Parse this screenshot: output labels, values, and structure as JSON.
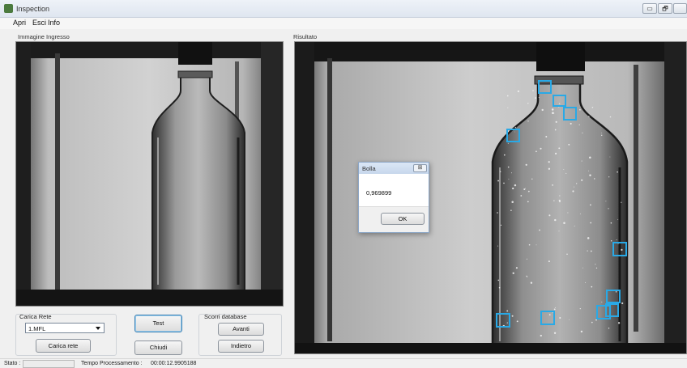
{
  "window": {
    "title": "Inspection",
    "controls": {
      "minimize": "▭",
      "maximize": "🗗",
      "close": ""
    }
  },
  "menu": {
    "items": [
      "Apri",
      "Esci",
      "Info"
    ]
  },
  "panels": {
    "input_label": "Immagine Ingresso",
    "result_label": "Risultato"
  },
  "controls": {
    "carica_rete": {
      "group_label": "Carica Rete",
      "selected": "1.MFL",
      "button": "Carica rete"
    },
    "test_button": "Test",
    "chiudi_button": "Chiudi",
    "scorri_database": {
      "group_label": "Scorri database",
      "next_button": "Avanti",
      "prev_button": "Indietro"
    }
  },
  "dialog": {
    "title": "Bolla",
    "close_label": "⊠",
    "message": "0,969899",
    "ok_button": "OK"
  },
  "status": {
    "stato_label": "Stato :",
    "time_label": "Tempo Processamento :",
    "time_value": "00:00:12.9905188"
  },
  "colors": {
    "detection_box": "#29a9e6",
    "focus_button": "#3c7fb1"
  },
  "icons": {
    "app": "app-icon",
    "dropdown": "chevron-down-icon"
  }
}
